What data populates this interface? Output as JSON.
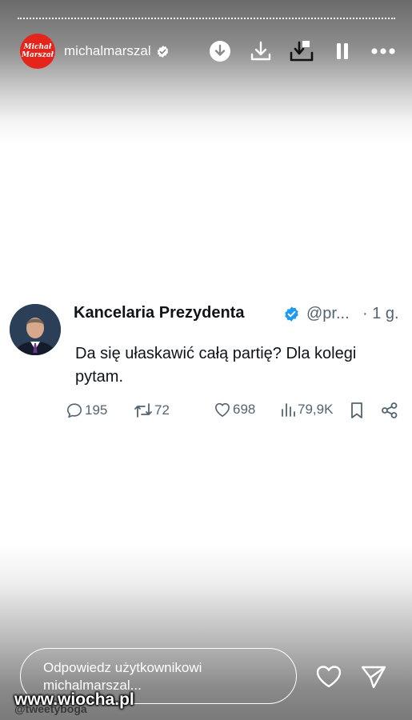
{
  "story": {
    "username": "michalmarszal",
    "avatar_text_line1": "Michał",
    "avatar_text_line2": "Marszał",
    "avatar_color": "#e5251b",
    "header_icons": [
      "download-circle-icon",
      "download-icon",
      "save-to-device-icon",
      "pause-icon",
      "more-icon"
    ]
  },
  "tweet": {
    "author": "Kancelaria Prezydenta",
    "handle": "@pr...",
    "time": "· 1 g.",
    "text": "Da się ułaskawić całą partię? Dla kolegi pytam.",
    "replies": "195",
    "retweets": "72",
    "likes": "698",
    "views": "79,9K",
    "verified_color": "#1d9bf0"
  },
  "reply": {
    "placeholder": "Odpowiedz użytkownikowi michalmarszal..."
  },
  "watermarks": {
    "site": "www.wiocha.pl",
    "source": "@tweetyboga"
  }
}
